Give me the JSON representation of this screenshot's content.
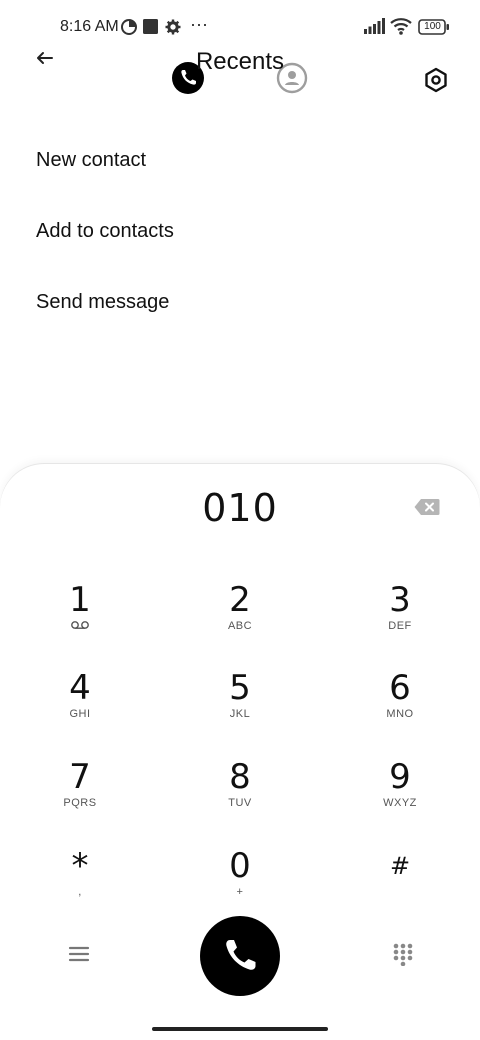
{
  "status_bar": {
    "time": "8:16 AM",
    "more": "···",
    "battery": "100"
  },
  "header": {
    "title": "Recents"
  },
  "actions": [
    {
      "label": "New contact"
    },
    {
      "label": "Add to contacts"
    },
    {
      "label": "Send message"
    }
  ],
  "dialer": {
    "number": "010",
    "keys": [
      {
        "digit": "1",
        "letters": "",
        "icon": "voicemail-icon"
      },
      {
        "digit": "2",
        "letters": "ABC"
      },
      {
        "digit": "3",
        "letters": "DEF"
      },
      {
        "digit": "4",
        "letters": "GHI"
      },
      {
        "digit": "5",
        "letters": "JKL"
      },
      {
        "digit": "6",
        "letters": "MNO"
      },
      {
        "digit": "7",
        "letters": "PQRS"
      },
      {
        "digit": "8",
        "letters": "TUV"
      },
      {
        "digit": "9",
        "letters": "WXYZ"
      },
      {
        "digit": "*",
        "letters": ","
      },
      {
        "digit": "0",
        "letters": "+"
      },
      {
        "digit": "#",
        "letters": ""
      }
    ]
  },
  "colors": {
    "accent": "#000000",
    "background": "#ffffff",
    "secondary_text": "#555555",
    "inactive_icon": "#9e9e9e"
  }
}
